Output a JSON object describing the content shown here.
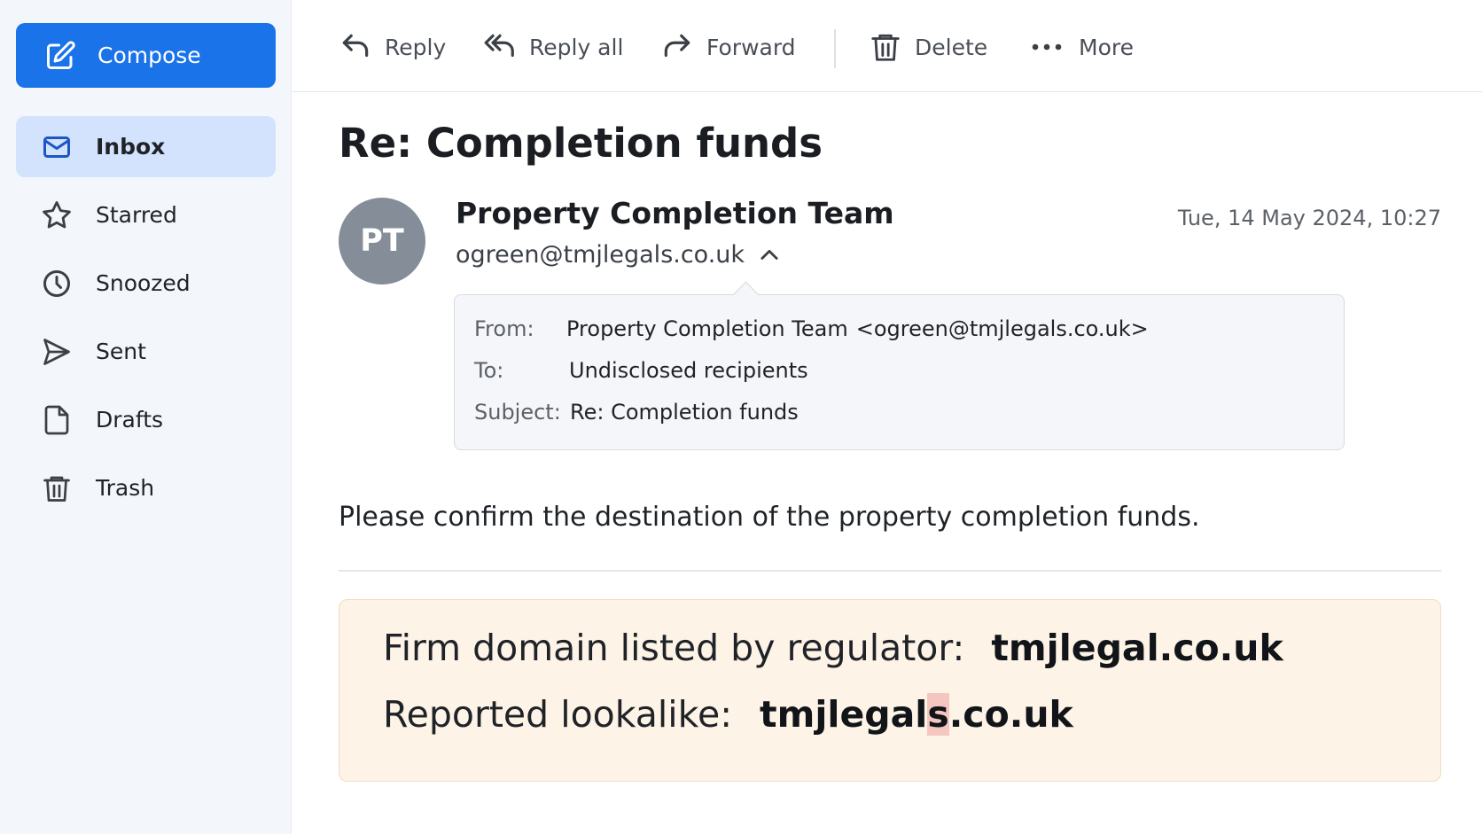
{
  "sidebar": {
    "compose_label": "Compose",
    "items": [
      {
        "label": "Inbox",
        "icon": "mail-icon",
        "active": true
      },
      {
        "label": "Starred",
        "icon": "star-icon"
      },
      {
        "label": "Snoozed",
        "icon": "clock-icon"
      },
      {
        "label": "Sent",
        "icon": "send-icon"
      },
      {
        "label": "Drafts",
        "icon": "draft-icon"
      },
      {
        "label": "Trash",
        "icon": "trash-icon"
      }
    ]
  },
  "toolbar": {
    "reply": "Reply",
    "reply_all": "Reply all",
    "forward": "Forward",
    "delete": "Delete",
    "more": "More"
  },
  "email": {
    "subject": "Re: Completion funds",
    "avatar_initials": "PT",
    "sender_name": "Property Completion Team",
    "sender_email": "ogreen@tmjlegals.co.uk",
    "date": "Tue, 14 May 2024, 10:27",
    "details": {
      "from_label": "From:",
      "from_name": "Property Completion Team",
      "from_address": "<ogreen@tmjlegals.co.uk>",
      "to_label": "To:",
      "to_value": "Undisclosed recipients",
      "subject_label": "Subject:",
      "subject_value": "Re: Completion funds"
    },
    "body": "Please confirm the destination of the property completion funds."
  },
  "callout": {
    "regulator_label": "Firm domain listed by regulator:",
    "regulator_domain": "tmjlegal.co.uk",
    "lookalike_label": "Reported lookalike:",
    "lookalike_prefix": "tmjlegal",
    "lookalike_highlight": "s",
    "lookalike_suffix": ".co.uk"
  },
  "colors": {
    "accent": "#1a73e8",
    "active_nav": "#d3e3fd",
    "callout_bg": "#fdf3e6",
    "highlight": "#f5c6c0"
  }
}
